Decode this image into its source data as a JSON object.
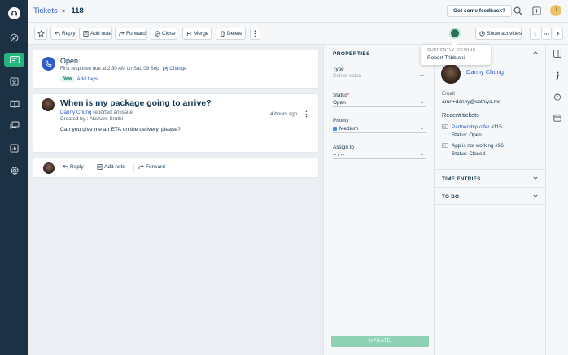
{
  "header": {
    "breadcrumb_root": "Tickets",
    "ticket_number": "118",
    "feedback_label": "Got some feedback?",
    "avatar_initial": "J"
  },
  "toolbar": {
    "reply": "Reply",
    "add_note": "Add note",
    "forward": "Forward",
    "close": "Close",
    "merge": "Merge",
    "delete": "Delete",
    "show_activities": "Show activities"
  },
  "tooltip": {
    "heading": "CURRENTLY VIEWING",
    "viewer": "Robert Tribbiani"
  },
  "status": {
    "title": "Open",
    "due_text": "First response due at 2:30 AM on Sat, 09 Sep",
    "change_label": "Change",
    "badge": "New",
    "add_tags": "Add tags"
  },
  "conversation": {
    "subject": "When is my package going to arrive?",
    "requester": "Danny Chung",
    "action": "reported an issue",
    "created_by": "Created by : Akshare Sruthi",
    "time": "4 hours ago",
    "body": "Can you give me an ETA on the delivery, please?"
  },
  "reply_bar": {
    "reply": "Reply",
    "add_note": "Add note",
    "forward": "Forward"
  },
  "properties": {
    "title": "PROPERTIES",
    "type_label": "Type",
    "type_placeholder": "Select value",
    "status_label": "Status",
    "status_required": "*",
    "status_value": "Open",
    "priority_label": "Priority",
    "priority_value": "Medium",
    "assign_label": "Assign to",
    "assign_value": "-- / --",
    "update_label": "UPDATE",
    "priority_color": "#4d8ae8"
  },
  "contact": {
    "name": "Danny Chung",
    "email_label": "Email",
    "email": "arun+danny@sathiya.me",
    "recent_title": "Recent tickets",
    "tickets": [
      {
        "title": "Partnership offer",
        "number": "#115",
        "status": "Status: Open"
      },
      {
        "title": "App is not working",
        "number": "#96",
        "status": "Status: Closed"
      }
    ],
    "time_entries": "TIME ENTRIES",
    "todo": "TO DO"
  },
  "colors": {
    "nav_bg": "#1d3144",
    "nav_active": "#24b47e",
    "link": "#2c5cc5",
    "update_button": "#8ed1b5"
  },
  "icons": [
    "logo-icon",
    "compass-icon",
    "tickets-icon",
    "contacts-icon",
    "book-icon",
    "chat-icon",
    "reports-icon",
    "settings-icon",
    "search-icon",
    "plus-box-icon",
    "star-icon",
    "phone-icon",
    "kebab-icon",
    "chevron-down-icon",
    "chevron-up-icon",
    "chevron-left-icon",
    "chevron-right-icon",
    "info-icon",
    "timer-icon",
    "calendar-icon",
    "panel-icon"
  ]
}
